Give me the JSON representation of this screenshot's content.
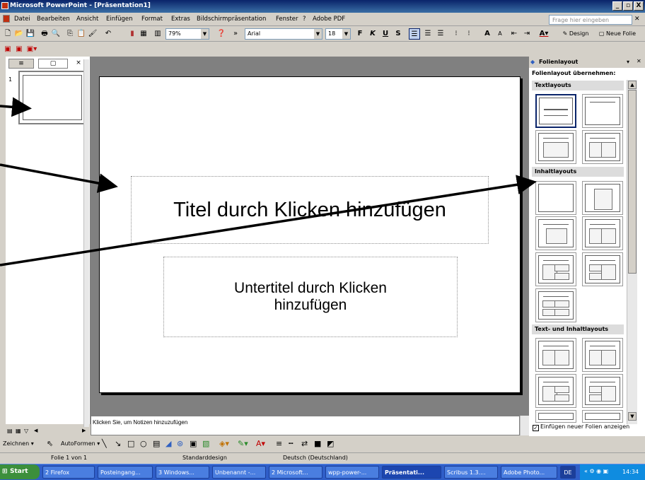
{
  "window": {
    "title": "Microsoft PowerPoint - [Präsentation1]",
    "controls": [
      "_",
      "▫",
      "X"
    ]
  },
  "menu": {
    "items": [
      "Datei",
      "Bearbeiten",
      "Ansicht",
      "Einfügen",
      "Format",
      "Extras",
      "Bildschirmpräsentation",
      "Fenster",
      "?",
      "Adobe PDF"
    ],
    "help_placeholder": "Frage hier eingeben"
  },
  "toolbar": {
    "zoom": "79%",
    "font": "Arial",
    "font_size": "18",
    "bold": "F",
    "italic": "K",
    "underline": "U",
    "shadow": "S",
    "design_label": "Design",
    "new_slide_label": "Neue Folie"
  },
  "left_pane": {
    "tab_outline": "≡",
    "tab_slides": "▢",
    "close": "×",
    "slide_number": "1"
  },
  "slide": {
    "title_placeholder": "Titel durch Klicken hinzufügen",
    "subtitle_placeholder": "Untertitel durch Klicken hinzufügen"
  },
  "notes": {
    "placeholder": "Klicken Sie, um Notizen hinzuzufügen"
  },
  "task_pane": {
    "title": "Folienlayout",
    "subtitle": "Folienlayout übernehmen:",
    "sections": {
      "text": "Textlayouts",
      "content": "Inhaltlayouts",
      "text_content": "Text- und Inhaltlayouts"
    },
    "checkbox_label": "Einfügen neuer Folien anzeigen",
    "checkbox_checked": true
  },
  "drawing_toolbar": {
    "draw_label": "Zeichnen",
    "autoshapes_label": "AutoFormen"
  },
  "status_bar": {
    "slide_info": "Folie 1 von 1",
    "design": "Standarddesign",
    "language": "Deutsch (Deutschland)"
  },
  "taskbar": {
    "start_label": "Start",
    "tasks": [
      "2 Firefox",
      "Posteingang...",
      "3 Windows...",
      "Unbenannt -...",
      "2 Microsoft...",
      "wpp-power-...",
      "Präsentati...",
      "Scribus 1.3....",
      "Adobe Photo...",
      "DE"
    ],
    "clock": "14:34"
  }
}
